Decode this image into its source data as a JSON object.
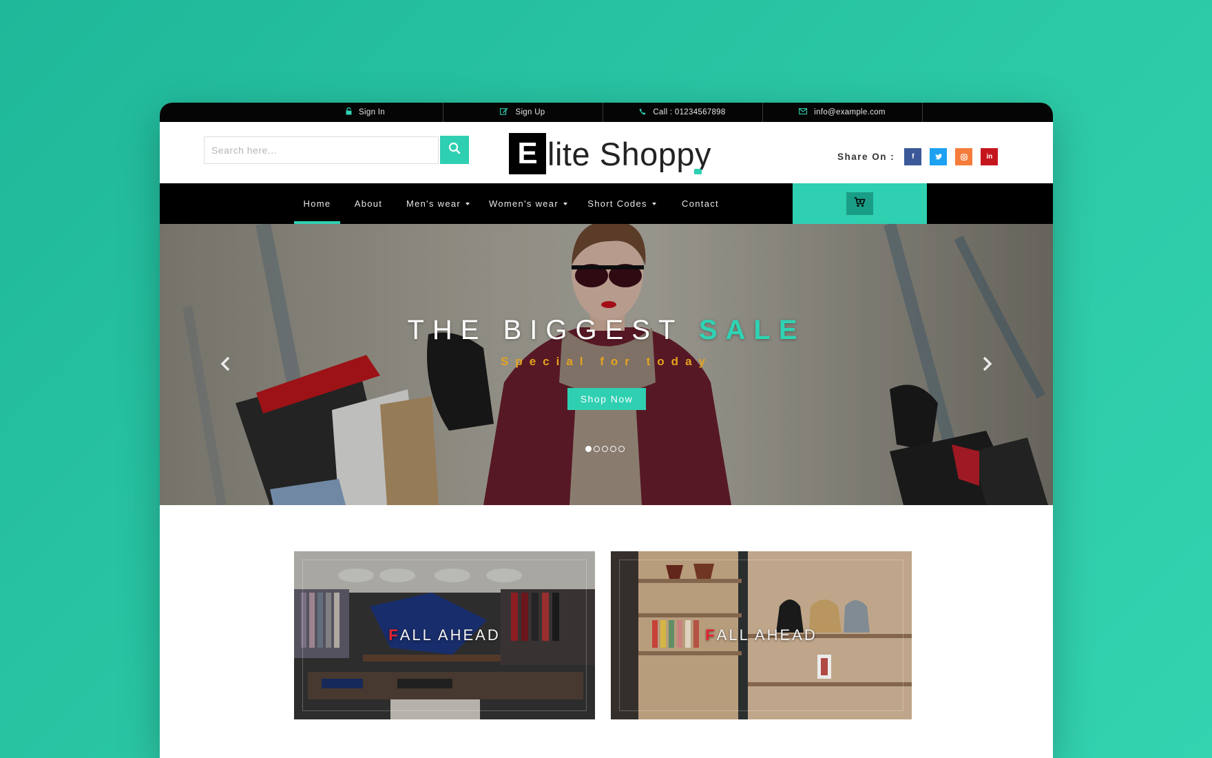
{
  "topbar": {
    "sign_in": "Sign In",
    "sign_up": "Sign Up",
    "call": "Call : 01234567898",
    "email": "info@example.com"
  },
  "header": {
    "search_placeholder": "Search here...",
    "logo_letter": "E",
    "logo_text": "lite Shoppy",
    "share_label": "Share On :",
    "social": [
      {
        "label": "f",
        "name": "facebook-icon",
        "color": "#3b5998"
      },
      {
        "label": "t",
        "name": "twitter-icon",
        "color": "#1da1f2"
      },
      {
        "label": "o",
        "name": "instagram-icon",
        "color": "#f57c3b"
      },
      {
        "label": "in",
        "name": "linkedin-icon",
        "color": "#c4161c"
      }
    ]
  },
  "nav": {
    "home": "Home",
    "about": "About",
    "mens": "Men's wear",
    "womens": "Women's wear",
    "short_codes": "Short Codes",
    "contact": "Contact"
  },
  "hero": {
    "title_main": "THE BIGGEST ",
    "title_accent": "SALE",
    "subtitle": "Special for today",
    "button": "Shop Now",
    "slides": 5,
    "active_slide": 1
  },
  "banners": [
    {
      "first_letter": "F",
      "rest": "ALL AHEAD"
    },
    {
      "first_letter": "F",
      "rest": "ALL AHEAD"
    }
  ],
  "colors": {
    "accent": "#2fcfb1",
    "background": "#2cc9a6",
    "sale_orange": "#e5a31f",
    "banner_red": "#e8222f"
  }
}
